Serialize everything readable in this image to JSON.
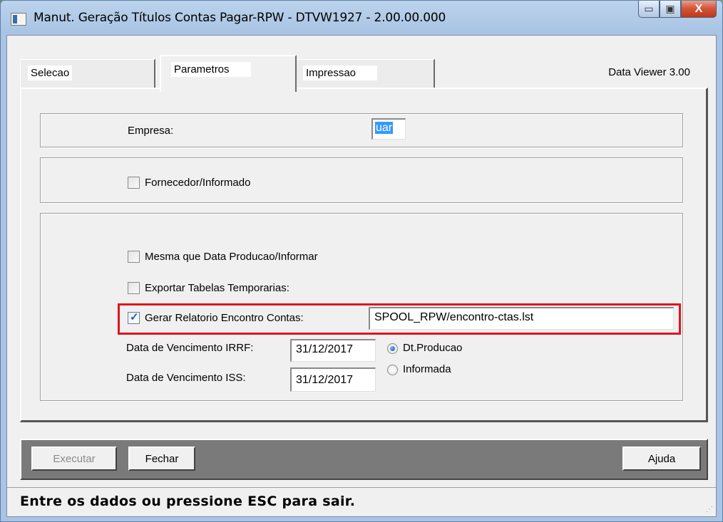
{
  "window": {
    "title": "Manut. Geração Títulos Contas Pagar-RPW - DTVW1927 - 2.00.00.000",
    "minimize_glyph": "▭",
    "maximize_glyph": "▣",
    "close_glyph": "X"
  },
  "tabs": [
    {
      "label": "Selecao",
      "active": false
    },
    {
      "label": "Parametros",
      "active": true
    },
    {
      "label": "Impressao",
      "active": false
    }
  ],
  "data_viewer_label": "Data Viewer 3.00",
  "empresa": {
    "label": "Empresa:",
    "value": "uar"
  },
  "fornecedor": {
    "label": "Fornecedor/Informado",
    "checked": false
  },
  "mesma_data": {
    "label": "Mesma que Data Producao/Informar",
    "checked": false
  },
  "exportar": {
    "label": "Exportar Tabelas Temporarias:",
    "checked": false
  },
  "gerar_relatorio": {
    "label": "Gerar Relatorio Encontro Contas:",
    "checked": true,
    "value": "SPOOL_RPW/encontro-ctas.lst",
    "check_glyph": "✓"
  },
  "venc_irrf": {
    "label": "Data de Vencimento IRRF:",
    "value": "31/12/2017"
  },
  "venc_iss": {
    "label": "Data de Vencimento ISS:",
    "value": "31/12/2017"
  },
  "radio_options": [
    {
      "label": "Dt.Producao",
      "selected": true
    },
    {
      "label": "Informada",
      "selected": false
    }
  ],
  "buttons": {
    "executar": "Executar",
    "fechar": "Fechar",
    "ajuda": "Ajuda"
  },
  "status": {
    "text": "Entre os dados ou pressione ESC para sair.",
    "grip_glyph": "⋰"
  },
  "colors": {
    "highlight": "#e0141e",
    "selection": "#3399ff"
  }
}
